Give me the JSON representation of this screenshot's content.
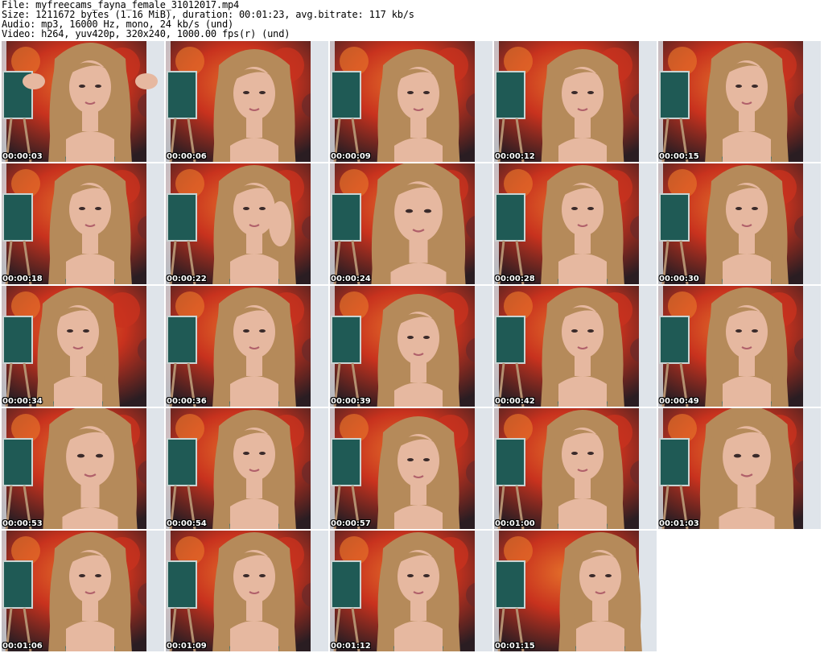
{
  "header": {
    "file_line": "File: myfreecams_fayna_female_31012017.mp4",
    "size_line": "Size: 1211672 bytes (1.16 MiB), duration: 00:01:23, avg.bitrate: 117 kb/s",
    "audio_line": "Audio: mp3, 16000 Hz, mono, 24 kb/s (und)",
    "video_line": "Video: h264, yuv420p, 320x240, 1000.00 fps(r) (und)"
  },
  "thumbnails": [
    {
      "time": "00:00:03",
      "pose": "hands-up"
    },
    {
      "time": "00:00:06",
      "pose": "down"
    },
    {
      "time": "00:00:09",
      "pose": "down"
    },
    {
      "time": "00:00:12",
      "pose": "down"
    },
    {
      "time": "00:00:15",
      "pose": "center"
    },
    {
      "time": "00:00:18",
      "pose": "center"
    },
    {
      "time": "00:00:22",
      "pose": "hand-face"
    },
    {
      "time": "00:00:24",
      "pose": "close"
    },
    {
      "time": "00:00:28",
      "pose": "center"
    },
    {
      "time": "00:00:30",
      "pose": "center"
    },
    {
      "time": "00:00:34",
      "pose": "left"
    },
    {
      "time": "00:00:36",
      "pose": "center"
    },
    {
      "time": "00:00:39",
      "pose": "down"
    },
    {
      "time": "00:00:42",
      "pose": "center"
    },
    {
      "time": "00:00:49",
      "pose": "center"
    },
    {
      "time": "00:00:53",
      "pose": "close"
    },
    {
      "time": "00:00:54",
      "pose": "center"
    },
    {
      "time": "00:00:57",
      "pose": "down"
    },
    {
      "time": "00:01:00",
      "pose": "center"
    },
    {
      "time": "00:01:03",
      "pose": "close"
    },
    {
      "time": "00:01:06",
      "pose": "center"
    },
    {
      "time": "00:01:09",
      "pose": "center"
    },
    {
      "time": "00:01:12",
      "pose": "center"
    },
    {
      "time": "00:01:15",
      "pose": "right"
    }
  ],
  "colors": {
    "wall_red": "#c8321e",
    "wall_orange": "#e4702a",
    "wall_dark": "#2a1d22",
    "wall_light": "#dfe4ea",
    "board": "#1f5a55",
    "hair": "#b58a5a",
    "skin": "#e6b8a0",
    "top": "#1e6f7a",
    "timestamp": "#ffffff"
  }
}
